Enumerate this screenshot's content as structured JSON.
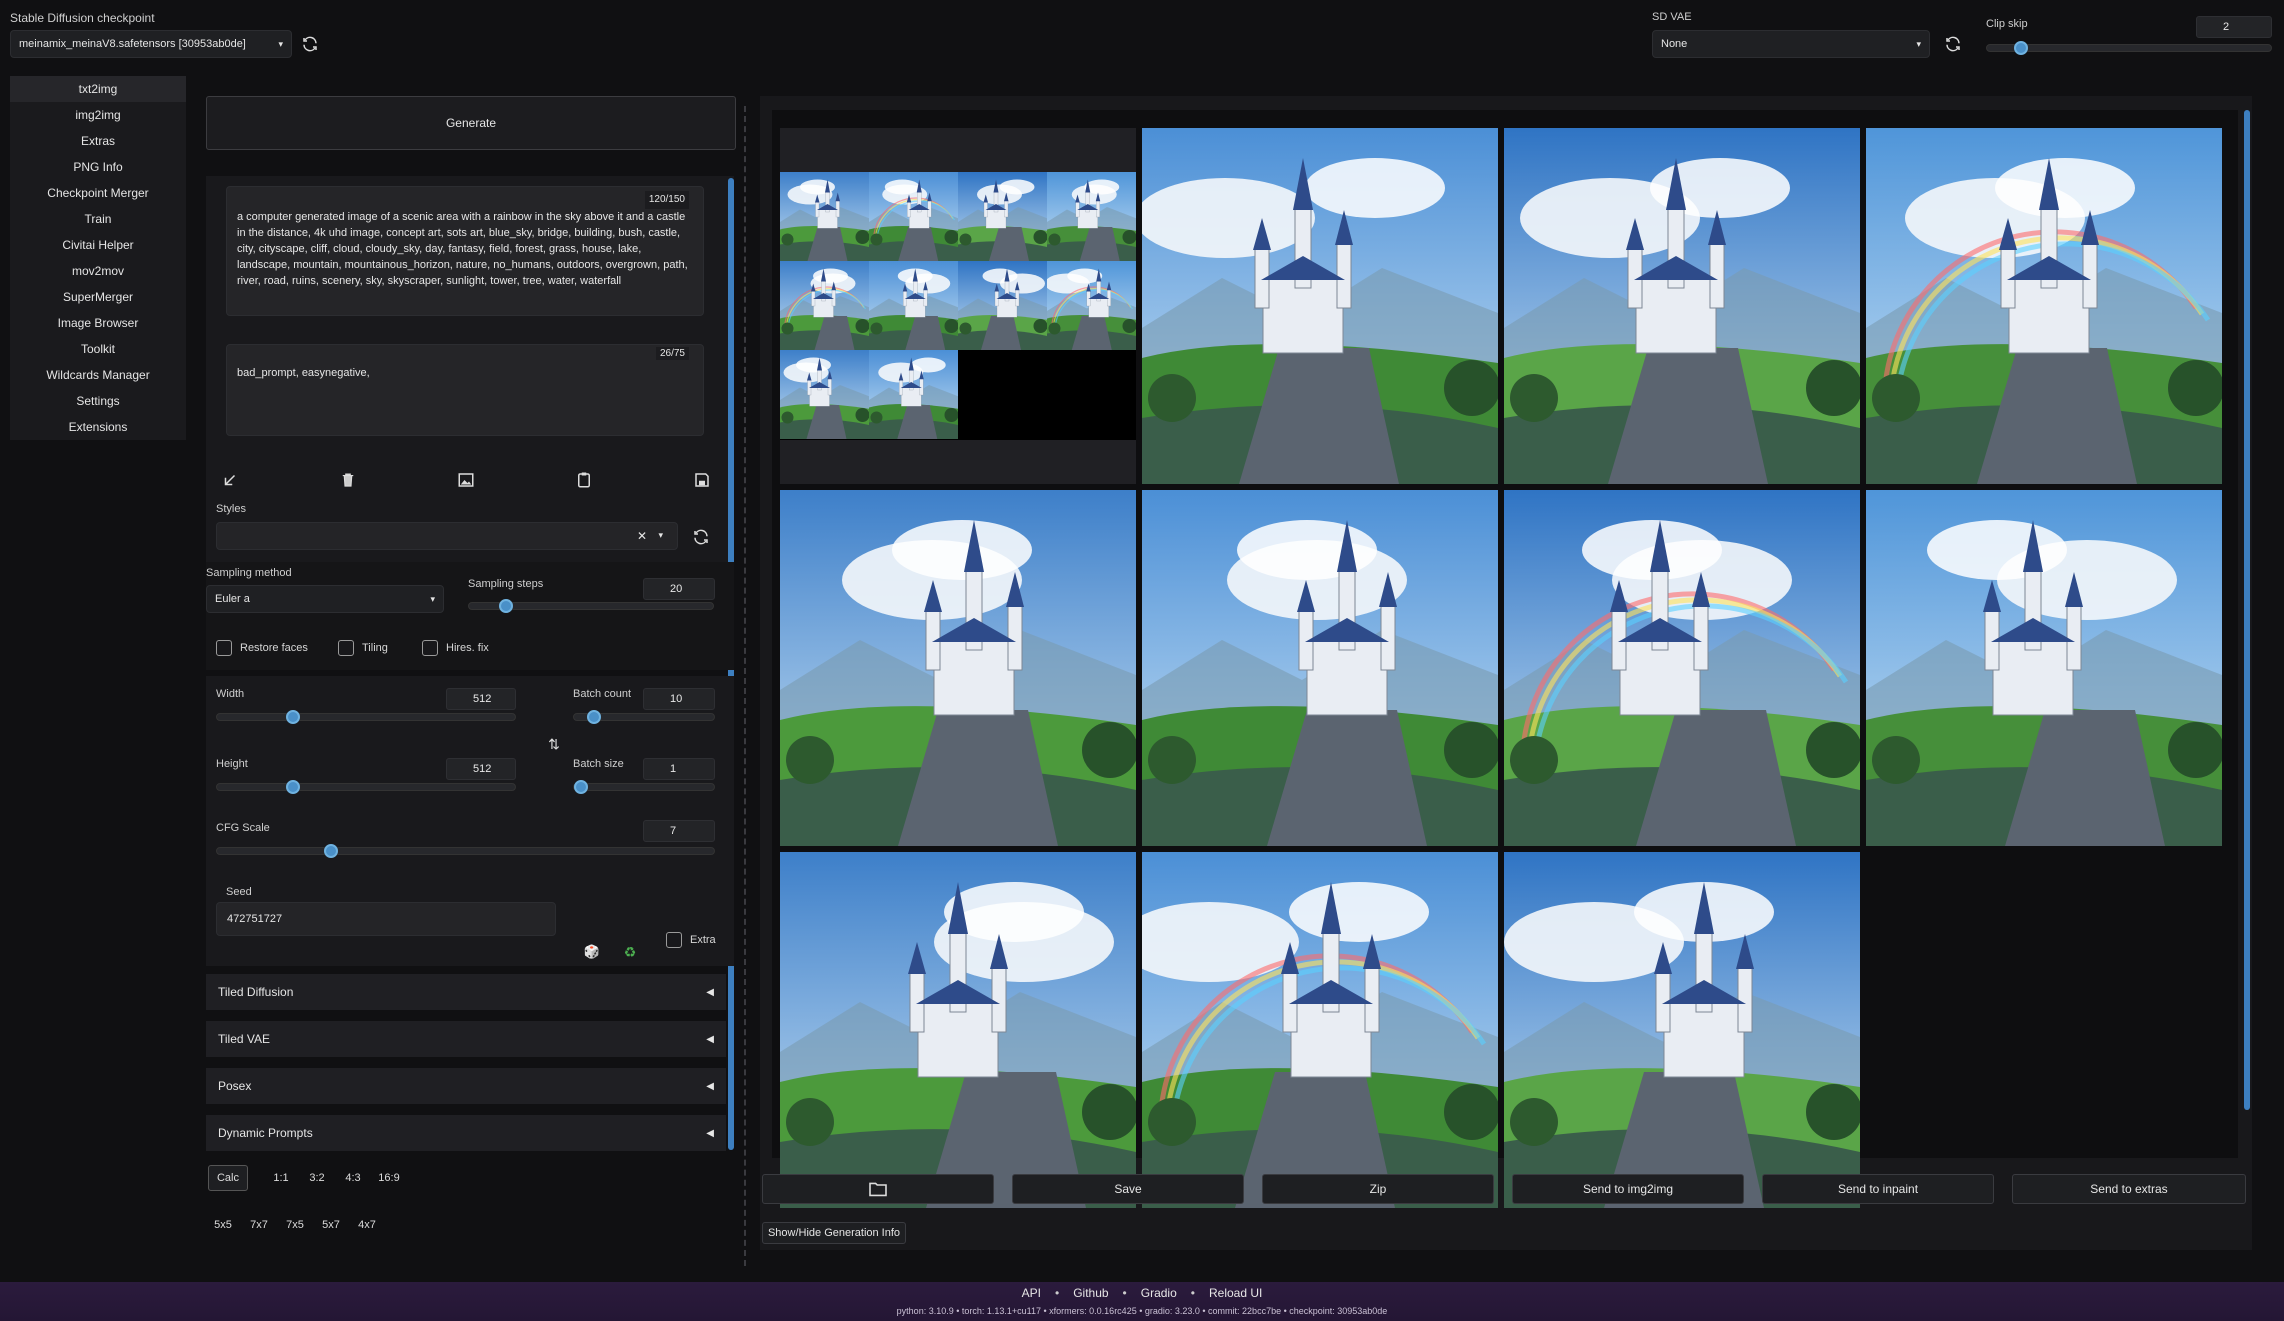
{
  "top": {
    "checkpoint_label": "Stable Diffusion checkpoint",
    "checkpoint_value": "meinamix_meinaV8.safetensors [30953ab0de]",
    "vae_label": "SD VAE",
    "vae_value": "None",
    "clip_label": "Clip skip",
    "clip_value": "2",
    "clip_fraction": 0.1
  },
  "sidebar": {
    "items": [
      {
        "label": "txt2img",
        "active": true
      },
      {
        "label": "img2img"
      },
      {
        "label": "Extras"
      },
      {
        "label": "PNG Info"
      },
      {
        "label": "Checkpoint Merger"
      },
      {
        "label": "Train"
      },
      {
        "label": "Civitai Helper"
      },
      {
        "label": "mov2mov"
      },
      {
        "label": "SuperMerger"
      },
      {
        "label": "Image Browser"
      },
      {
        "label": "Toolkit"
      },
      {
        "label": "Wildcards Manager"
      },
      {
        "label": "Settings"
      },
      {
        "label": "Extensions"
      }
    ]
  },
  "generate": {
    "label": "Generate"
  },
  "prompt": {
    "counter": "120/150",
    "text": "a computer generated image of a scenic area with a rainbow in the sky above it and a castle in the distance, 4k uhd image, concept art, sots art, blue_sky, bridge, building, bush, castle, city, cityscape, cliff, cloud, cloudy_sky, day, fantasy, field, forest, grass, house, lake, landscape, mountain, mountainous_horizon, nature, no_humans, outdoors, overgrown, path, river, road, ruins, scenery, sky, skyscraper, sunlight, tower, tree, water, waterfall"
  },
  "negative": {
    "counter": "26/75",
    "text": "bad_prompt, easynegative,"
  },
  "styles": {
    "label": "Styles"
  },
  "sampling": {
    "method_label": "Sampling method",
    "method_value": "Euler a",
    "steps_label": "Sampling steps",
    "steps_value": "20",
    "steps_fraction": 0.13
  },
  "checks": {
    "restore_faces": "Restore faces",
    "tiling": "Tiling",
    "hires": "Hires. fix"
  },
  "dims": {
    "width_label": "Width",
    "width_value": "512",
    "width_fraction": 0.24,
    "height_label": "Height",
    "height_value": "512",
    "height_fraction": 0.24,
    "batch_count_label": "Batch count",
    "batch_count_value": "10",
    "batch_count_fraction": 0.1,
    "batch_size_label": "Batch size",
    "batch_size_value": "1",
    "batch_size_fraction": 0.0,
    "swap_icon": "swap-icon"
  },
  "cfg": {
    "label": "CFG Scale",
    "value": "7",
    "fraction": 0.22
  },
  "seed": {
    "label": "Seed",
    "value": "472751727",
    "extra_label": "Extra"
  },
  "accordions": [
    "Tiled Diffusion",
    "Tiled VAE",
    "Posex",
    "Dynamic Prompts"
  ],
  "ratios1": [
    "Calc",
    "1:1",
    "3:2",
    "4:3",
    "16:9"
  ],
  "ratios2": [
    "5x5",
    "7x7",
    "7x5",
    "5x7",
    "4x7"
  ],
  "actions": {
    "save": "Save",
    "zip": "Zip",
    "img2img": "Send to img2img",
    "inpaint": "Send to inpaint",
    "extras": "Send to extras",
    "info": "Show/Hide Generation Info"
  },
  "footer": {
    "links": [
      "API",
      "Github",
      "Gradio",
      "Reload UI"
    ],
    "version": "python: 3.10.9  •  torch: 1.13.1+cu117  •  xformers: 0.0.16rc425  •  gradio: 3.23.0  •  commit: 22bcc7be  •  checkpoint: 30953ab0de"
  },
  "colors": {
    "accent": "#4a90c8",
    "footer": "#2a1a3a"
  }
}
